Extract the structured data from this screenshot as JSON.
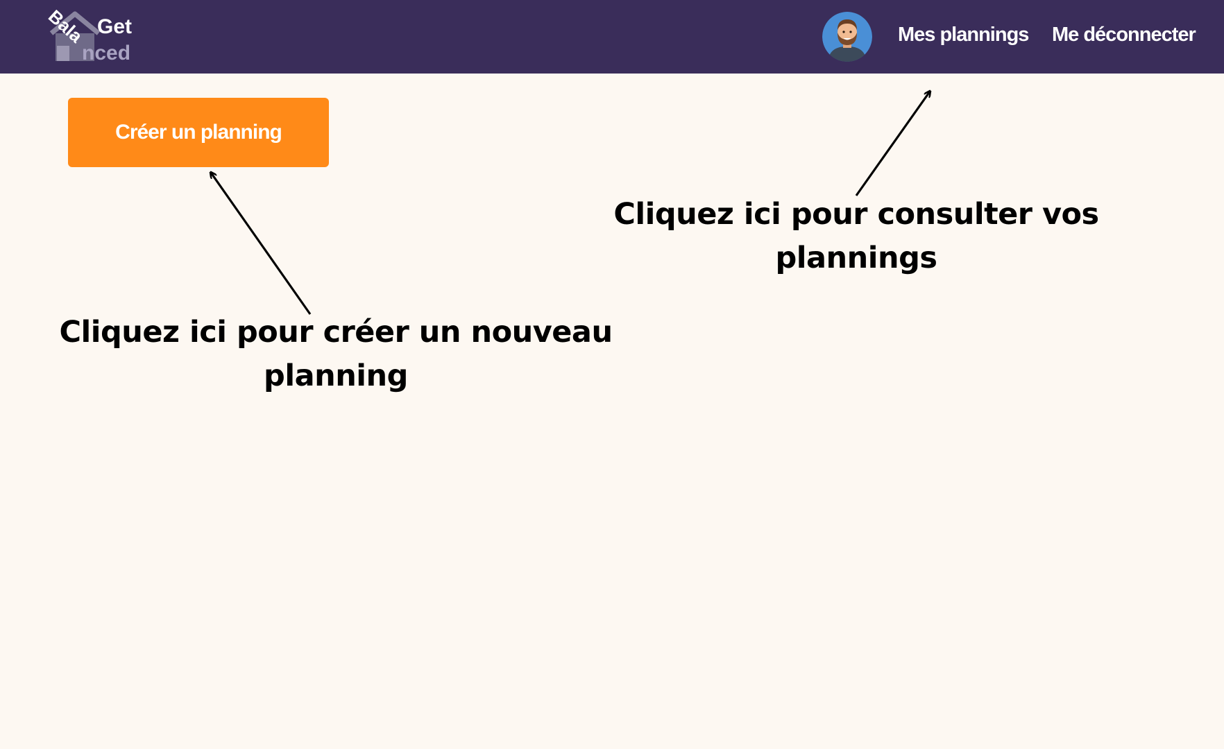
{
  "header": {
    "logo": {
      "word_top": "Get",
      "word_bottom_rotated": "Bala",
      "word_bottom": "nced"
    },
    "avatar_icon": "man-avatar-icon",
    "nav": {
      "plannings_label": "Mes plannings",
      "logout_label": "Me déconnecter"
    }
  },
  "main": {
    "create_button_label": "Créer un planning"
  },
  "annotations": {
    "create": {
      "line1": "Cliquez ici pour créer un nouveau",
      "line2": "planning"
    },
    "plannings": {
      "line1": "Cliquez ici pour consulter vos",
      "line2": "plannings"
    }
  },
  "colors": {
    "header_bg": "#3a2d5a",
    "page_bg": "#fdf8f2",
    "button_bg": "#ff8a18",
    "avatar_bg": "#4a8fd6"
  }
}
